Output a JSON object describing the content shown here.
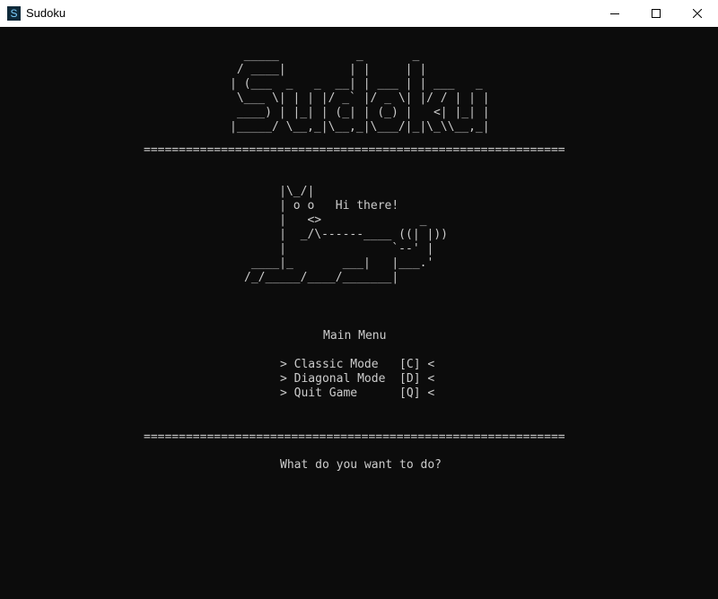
{
  "window": {
    "title": "Sudoku",
    "icon_glyph": "S",
    "icon": "app-terminal-icon",
    "controls": [
      "minimize-icon",
      "maximize-icon",
      "close-icon"
    ]
  },
  "console": {
    "background": "#0c0c0c",
    "foreground": "#cccccc",
    "logo_ascii": "  _____           _       _          \n / ____|         | |     | |         \n| (___  _   _  __| | ___ | | ___   _ \n \\___ \\| | | |/ _` |/ _ \\| |/ / | | |\n ____) | |_| | (_| | (_) |   <| |_| |\n|_____/ \\__,_|\\__,_|\\___/|_|\\_\\\\__,_|",
    "separator": "============================================================",
    "cat_ascii": "     |\\_/|\n     | o o   Hi there!\n     |   <>              _\n     |  _/\\------____ ((| |))\n     |               `--' |\n ____|_       ___|   |___.'\n/_/_____/____/_______|",
    "menu_title": "Main Menu",
    "options": [
      {
        "label": "> Classic Mode   [C] <"
      },
      {
        "label": "> Diagonal Mode  [D] <"
      },
      {
        "label": "> Quit Game      [Q] <"
      }
    ],
    "prompt": "What do you want to do?"
  }
}
